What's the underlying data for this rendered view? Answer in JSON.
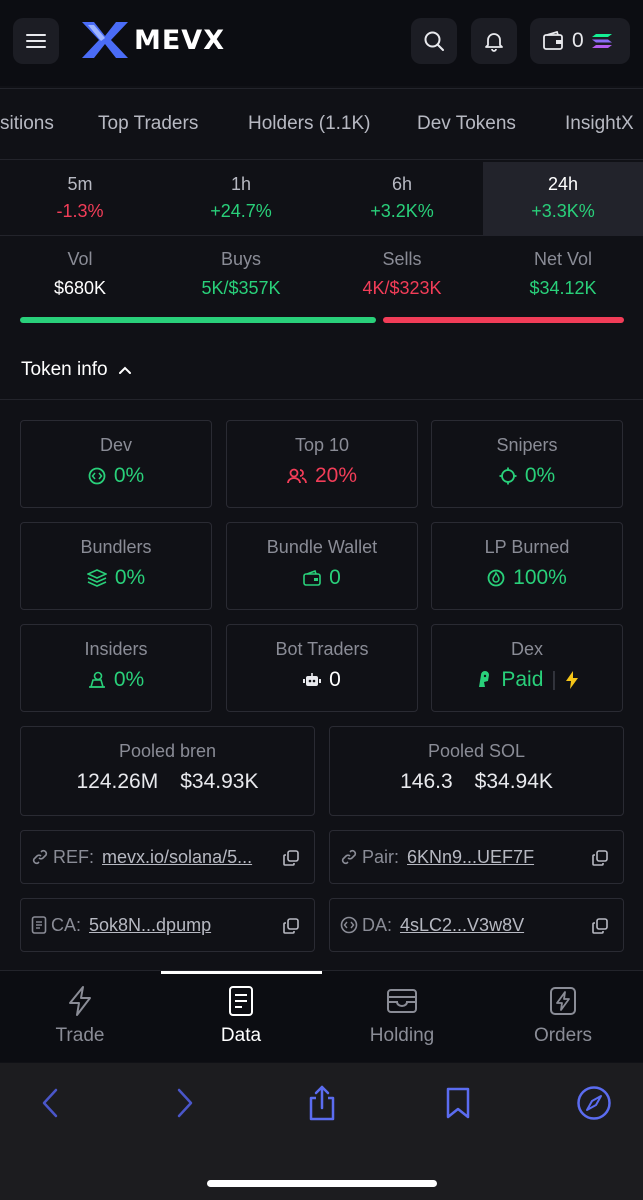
{
  "header": {
    "logo_text": "MEVX",
    "wallet_count": "0",
    "icons": [
      "menu-icon",
      "search-icon",
      "bell-icon",
      "wallet-icon",
      "solana-icon"
    ]
  },
  "tabs": [
    "sitions",
    "Top Traders",
    "Holders (1.1K)",
    "Dev Tokens",
    "InsightX"
  ],
  "timeframes": [
    {
      "label": "5m",
      "value": "-1.3%",
      "trend": "down"
    },
    {
      "label": "1h",
      "value": "+24.7%",
      "trend": "up"
    },
    {
      "label": "6h",
      "value": "+3.2K%",
      "trend": "up"
    },
    {
      "label": "24h",
      "value": "+3.3K%",
      "trend": "up",
      "active": true
    }
  ],
  "stats": [
    {
      "label": "Vol",
      "value": "$680K"
    },
    {
      "label": "Buys",
      "value": "5K/$357K"
    },
    {
      "label": "Sells",
      "value": "4K/$323K"
    },
    {
      "label": "Net Vol",
      "value": "$34.12K"
    }
  ],
  "buy_sell_ratio": {
    "buys": 0.525,
    "sells": 0.475
  },
  "token_info": {
    "title": "Token info",
    "metrics": [
      {
        "label": "Dev",
        "value": "0%",
        "icon": "code-icon",
        "status": "green"
      },
      {
        "label": "Top 10",
        "value": "20%",
        "icon": "users-icon",
        "status": "red"
      },
      {
        "label": "Snipers",
        "value": "0%",
        "icon": "crosshair-icon",
        "status": "green"
      },
      {
        "label": "Bundlers",
        "value": "0%",
        "icon": "layers-icon",
        "status": "green"
      },
      {
        "label": "Bundle Wallet",
        "value": "0",
        "icon": "wallet-icon",
        "status": "green"
      },
      {
        "label": "LP Burned",
        "value": "100%",
        "icon": "flame-icon",
        "status": "green"
      },
      {
        "label": "Insiders",
        "value": "0%",
        "icon": "insider-icon",
        "status": "green"
      },
      {
        "label": "Bot Traders",
        "value": "0",
        "icon": "robot-icon",
        "status": "white"
      },
      {
        "label": "Dex",
        "value": "Paid",
        "icon": "dex-icon",
        "status": "green",
        "extra_icon": "lightning-icon"
      }
    ],
    "pooled": [
      {
        "label": "Pooled bren",
        "amount": "124.26M",
        "usd": "$34.93K"
      },
      {
        "label": "Pooled SOL",
        "amount": "146.3",
        "usd": "$34.94K"
      }
    ],
    "links": [
      {
        "label": "REF:",
        "value": "mevx.io/solana/5...",
        "icon": "link-icon"
      },
      {
        "label": "Pair:",
        "value": "6KNn9...UEF7F",
        "icon": "link-icon"
      },
      {
        "label": "CA:",
        "value": "5ok8N...dpump",
        "icon": "document-icon"
      },
      {
        "label": "DA:",
        "value": "4sLC2...V3w8V",
        "icon": "code-icon"
      }
    ]
  },
  "bottom_nav": [
    {
      "label": "Trade",
      "icon": "lightning-icon"
    },
    {
      "label": "Data",
      "icon": "document-icon",
      "active": true
    },
    {
      "label": "Holding",
      "icon": "holding-icon"
    },
    {
      "label": "Orders",
      "icon": "orders-icon"
    }
  ],
  "colors": {
    "green": "#29d07a",
    "red": "#f23d58",
    "accent": "#5b6cf0",
    "background": "#101116"
  }
}
